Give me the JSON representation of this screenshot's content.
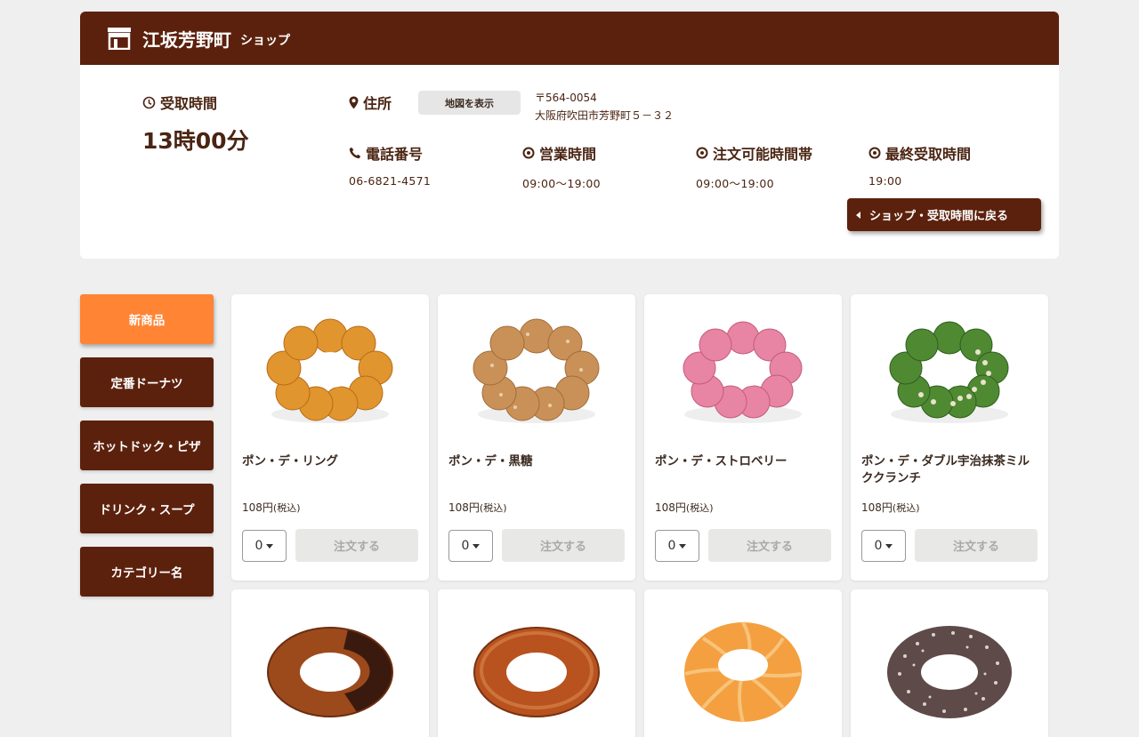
{
  "shop": {
    "name": "江坂芳野町",
    "suffix": "ショップ"
  },
  "pickup": {
    "label": "受取時間",
    "time": "13時00分"
  },
  "address": {
    "label": "住所",
    "map_button": "地図を表示",
    "postal": "〒564-0054",
    "street": "大阪府吹田市芳野町５－３２"
  },
  "info": {
    "phone": {
      "label": "電話番号",
      "value": "06-6821-4571"
    },
    "hours": {
      "label": "営業時間",
      "value": "09:00〜19:00"
    },
    "order_hours": {
      "label": "注文可能時間帯",
      "value": "09:00〜19:00"
    },
    "last_pickup": {
      "label": "最終受取時間",
      "value": "19:00"
    }
  },
  "back_button": "ショップ・受取時間に戻る",
  "categories": [
    {
      "label": "新商品",
      "active": true
    },
    {
      "label": "定番ドーナツ",
      "active": false
    },
    {
      "label": "ホットドック・ピザ",
      "active": false
    },
    {
      "label": "ドリンク・スープ",
      "active": false
    },
    {
      "label": "カテゴリー名",
      "active": false
    }
  ],
  "products": [
    {
      "name": "ポン・デ・リング",
      "price": "108円",
      "tax": "(税込)",
      "qty": "0",
      "order": "注文する",
      "image": "pon-de-ring"
    },
    {
      "name": "ポン・デ・黒糖",
      "price": "108円",
      "tax": "(税込)",
      "qty": "0",
      "order": "注文する",
      "image": "pon-de-kokuto"
    },
    {
      "name": "ポン・デ・ストロベリー",
      "price": "108円",
      "tax": "(税込)",
      "qty": "0",
      "order": "注文する",
      "image": "pon-de-strawberry"
    },
    {
      "name": "ポン・デ・ダブル宇治抹茶ミルククランチ",
      "price": "108円",
      "tax": "(税込)",
      "qty": "0",
      "order": "注文する",
      "image": "pon-de-matcha"
    },
    {
      "image": "chocolate-dip-old-fashioned"
    },
    {
      "image": "honey-dip-old-fashioned"
    },
    {
      "image": "french-cruller"
    },
    {
      "image": "coconut-chocolate"
    }
  ],
  "colors": {
    "brand": "#5c210d",
    "accent": "#ff8434",
    "background": "#efefef"
  }
}
